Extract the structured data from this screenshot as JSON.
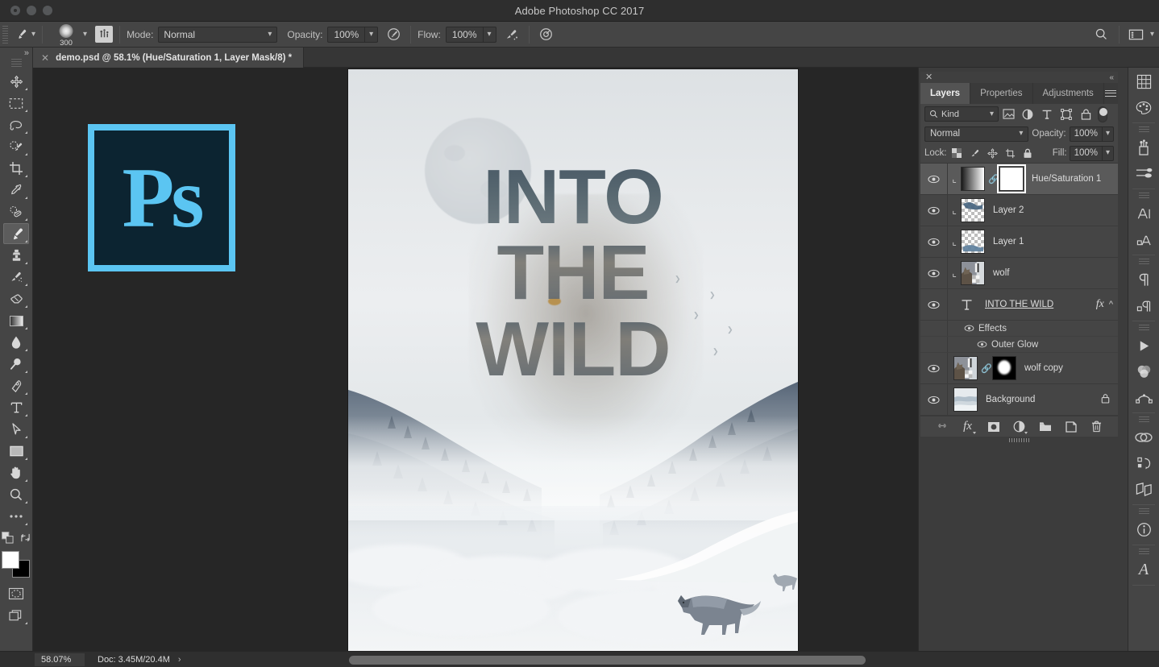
{
  "titlebar": {
    "app_title": "Adobe Photoshop CC 2017"
  },
  "options_bar": {
    "brush_size": "300",
    "mode_label": "Mode:",
    "mode_value": "Normal",
    "opacity_label": "Opacity:",
    "opacity_value": "100%",
    "flow_label": "Flow:",
    "flow_value": "100%",
    "airbrush_icon": "airbrush-icon",
    "smoothing_icon": "smoothing-icon",
    "tablet_pressure_icon": "tablet-pressure-icon",
    "brush_preset_icon": "brush-preset-picker",
    "brush_panel_icon": "brush-settings-panel-icon",
    "search_icon": "search-icon",
    "workspace_icon": "workspace-switcher-icon"
  },
  "document_tab": {
    "close_icon": "close-icon",
    "title": "demo.psd @ 58.1% (Hue/Saturation 1, Layer Mask/8) *"
  },
  "toolbar": {
    "expand_label": "»",
    "tools": [
      {
        "name": "move-tool",
        "glyph": "move"
      },
      {
        "name": "rectangular-marquee-tool",
        "glyph": "marquee"
      },
      {
        "name": "lasso-tool",
        "glyph": "lasso"
      },
      {
        "name": "quick-selection-tool",
        "glyph": "quickselect"
      },
      {
        "name": "crop-tool",
        "glyph": "crop"
      },
      {
        "name": "eyedropper-tool",
        "glyph": "eyedropper"
      },
      {
        "name": "spot-healing-brush-tool",
        "glyph": "healing"
      },
      {
        "name": "brush-tool",
        "glyph": "brush",
        "active": true
      },
      {
        "name": "clone-stamp-tool",
        "glyph": "stamp"
      },
      {
        "name": "history-brush-tool",
        "glyph": "historybrush"
      },
      {
        "name": "eraser-tool",
        "glyph": "eraser"
      },
      {
        "name": "gradient-tool",
        "glyph": "gradient"
      },
      {
        "name": "blur-tool",
        "glyph": "blur"
      },
      {
        "name": "dodge-tool",
        "glyph": "dodge"
      },
      {
        "name": "pen-tool",
        "glyph": "pen"
      },
      {
        "name": "horizontal-type-tool",
        "glyph": "type"
      },
      {
        "name": "path-selection-tool",
        "glyph": "pathselect"
      },
      {
        "name": "rectangle-tool",
        "glyph": "rectangle"
      },
      {
        "name": "hand-tool",
        "glyph": "hand"
      },
      {
        "name": "zoom-tool",
        "glyph": "zoom"
      },
      {
        "name": "edit-toolbar-tool",
        "glyph": "ellipsis"
      }
    ],
    "swap_colors_icon": "swap-colors-icon",
    "default_colors_icon": "default-colors-icon",
    "foreground_color": "#ffffff",
    "background_color": "#000000",
    "quick_mask_icon": "quick-mask-mode-icon",
    "screen_mode_icon": "screen-mode-icon"
  },
  "canvas": {
    "splash_logo_text": "Ps",
    "splash_bg": "#0c2431",
    "splash_accent": "#5bc5f2",
    "artwork": {
      "headline_lines": [
        "INTO",
        "THE",
        "WILD"
      ],
      "scene": "wolf-winter-forest-poster"
    }
  },
  "layers_panel": {
    "close_icon": "close-icon",
    "collapse_icon": "collapse-panel-icon",
    "tabs": [
      {
        "label": "Layers",
        "selected": true
      },
      {
        "label": "Properties",
        "selected": false
      },
      {
        "label": "Adjustments",
        "selected": false
      }
    ],
    "menu_icon": "panel-menu-icon",
    "filter": {
      "kind_label": "Kind",
      "search_icon": "search-icon",
      "icons": [
        "pixel-layer-filter-icon",
        "adjustment-layer-filter-icon",
        "type-layer-filter-icon",
        "shape-layer-filter-icon",
        "smart-object-filter-icon"
      ],
      "toggle_icon": "filter-toggle-switch"
    },
    "blend_mode": "Normal",
    "opacity_label": "Opacity:",
    "opacity_value": "100%",
    "lock_label": "Lock:",
    "lock_icons": [
      "lock-transparent-pixels-icon",
      "lock-image-pixels-icon",
      "lock-position-icon",
      "lock-artboard-nesting-icon",
      "lock-all-icon"
    ],
    "fill_label": "Fill:",
    "fill_value": "100%",
    "layers": [
      {
        "name": "Hue/Saturation 1",
        "visible": true,
        "selected": true,
        "clipped": true,
        "thumb_kind": "gradient-adjustment",
        "has_link": true,
        "has_mask": true,
        "mask_selected": true,
        "has_fx": false,
        "locked": false,
        "renaming": false
      },
      {
        "name": "Layer 2",
        "visible": true,
        "selected": false,
        "clipped": true,
        "thumb_kind": "transparent-top",
        "has_link": false,
        "has_mask": false,
        "has_fx": false,
        "locked": false,
        "renaming": false
      },
      {
        "name": "Layer 1",
        "visible": true,
        "selected": false,
        "clipped": true,
        "thumb_kind": "transparent-bottom",
        "has_link": false,
        "has_mask": false,
        "has_fx": false,
        "locked": false,
        "renaming": false
      },
      {
        "name": "wolf",
        "visible": true,
        "selected": false,
        "clipped": true,
        "thumb_kind": "wolf-photo",
        "has_link": false,
        "has_mask": false,
        "has_fx": false,
        "locked": false,
        "renaming": false
      },
      {
        "name": "INTO THE WILD",
        "visible": true,
        "selected": false,
        "clipped": false,
        "thumb_kind": "type-layer",
        "has_link": false,
        "has_mask": false,
        "has_fx": true,
        "fx_label": "fx",
        "expand_icon": "chevron-up-icon",
        "locked": false,
        "renaming": true,
        "effects": {
          "group_label": "Effects",
          "items": [
            "Outer Glow"
          ]
        }
      },
      {
        "name": "wolf copy",
        "visible": true,
        "selected": false,
        "clipped": false,
        "thumb_kind": "wolf-photo",
        "has_link": true,
        "has_mask": true,
        "mask_kind": "black-white-blob",
        "has_fx": false,
        "locked": false,
        "renaming": false
      },
      {
        "name": "Background",
        "visible": true,
        "selected": false,
        "clipped": false,
        "thumb_kind": "background-photo",
        "has_link": false,
        "has_mask": false,
        "has_fx": false,
        "locked": true,
        "lock_icon": "lock-icon",
        "renaming": false
      }
    ],
    "footer_icons": [
      "link-layers-icon",
      "add-layer-style-icon",
      "add-layer-mask-icon",
      "new-fill-adjustment-layer-icon",
      "new-group-icon",
      "new-layer-icon",
      "delete-layer-icon"
    ]
  },
  "right_rail": {
    "groups": [
      [
        "color-panel-icon",
        "swatches-panel-icon"
      ],
      [
        "brush-presets-icon",
        "brush-settings-icon"
      ],
      [
        "character-panel-icon",
        "paragraph-styles-icon"
      ],
      [
        "paragraph-panel-icon",
        "character-styles-icon"
      ],
      [
        "timeline-panel-icon",
        "channels-panel-icon",
        "paths-panel-icon"
      ],
      [
        "layer-comps-icon",
        "history-panel-icon",
        "actions-panel-icon"
      ],
      [
        "info-panel-icon"
      ],
      [
        "glyphs-panel-icon"
      ]
    ]
  },
  "status_bar": {
    "zoom": "58.07%",
    "doc_info": "Doc: 3.45M/20.4M",
    "expand_arrow": "›"
  }
}
